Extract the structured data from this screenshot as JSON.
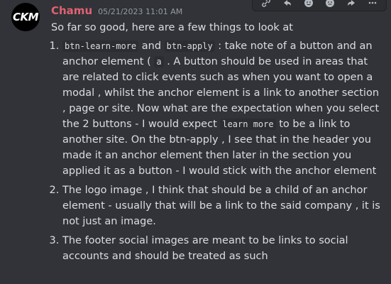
{
  "message": {
    "avatar_text": "CKM",
    "username": "Chamu",
    "timestamp": "05/21/2023 11:01 AM",
    "intro": "So far so good, here are a few things to look at",
    "items": [
      {
        "parts": [
          {
            "code": "btn-learn-more"
          },
          {
            "text": " and "
          },
          {
            "code": "btn-apply"
          },
          {
            "text": " : take note of a button and an anchor element ( "
          },
          {
            "code": "a"
          },
          {
            "text": " . A button should be used in areas that are related to click events such as when you want to open a modal , whilst the anchor element is a link to another section , page or site. Now what are the expectation when you select the 2 buttons - I would expect "
          },
          {
            "code": "learn more"
          },
          {
            "text": " to be a link to another site. On the btn-apply , I see that in the header you made it an anchor element then later in the section you applied it as a button - I would stick with the anchor element"
          }
        ]
      },
      {
        "parts": [
          {
            "text": "The logo image , I think that should be a child of an anchor element - usually that will be a link to the said company , it is not just an image."
          }
        ]
      },
      {
        "parts": [
          {
            "text": "The footer social images are meant to be links to social accounts and should be treated as such"
          }
        ]
      }
    ]
  },
  "toolbar": {
    "icons": [
      "link-icon",
      "reply-arrow-icon",
      "emoji-icon",
      "emoji-add-icon",
      "forward-icon",
      "more-options-icon"
    ]
  }
}
